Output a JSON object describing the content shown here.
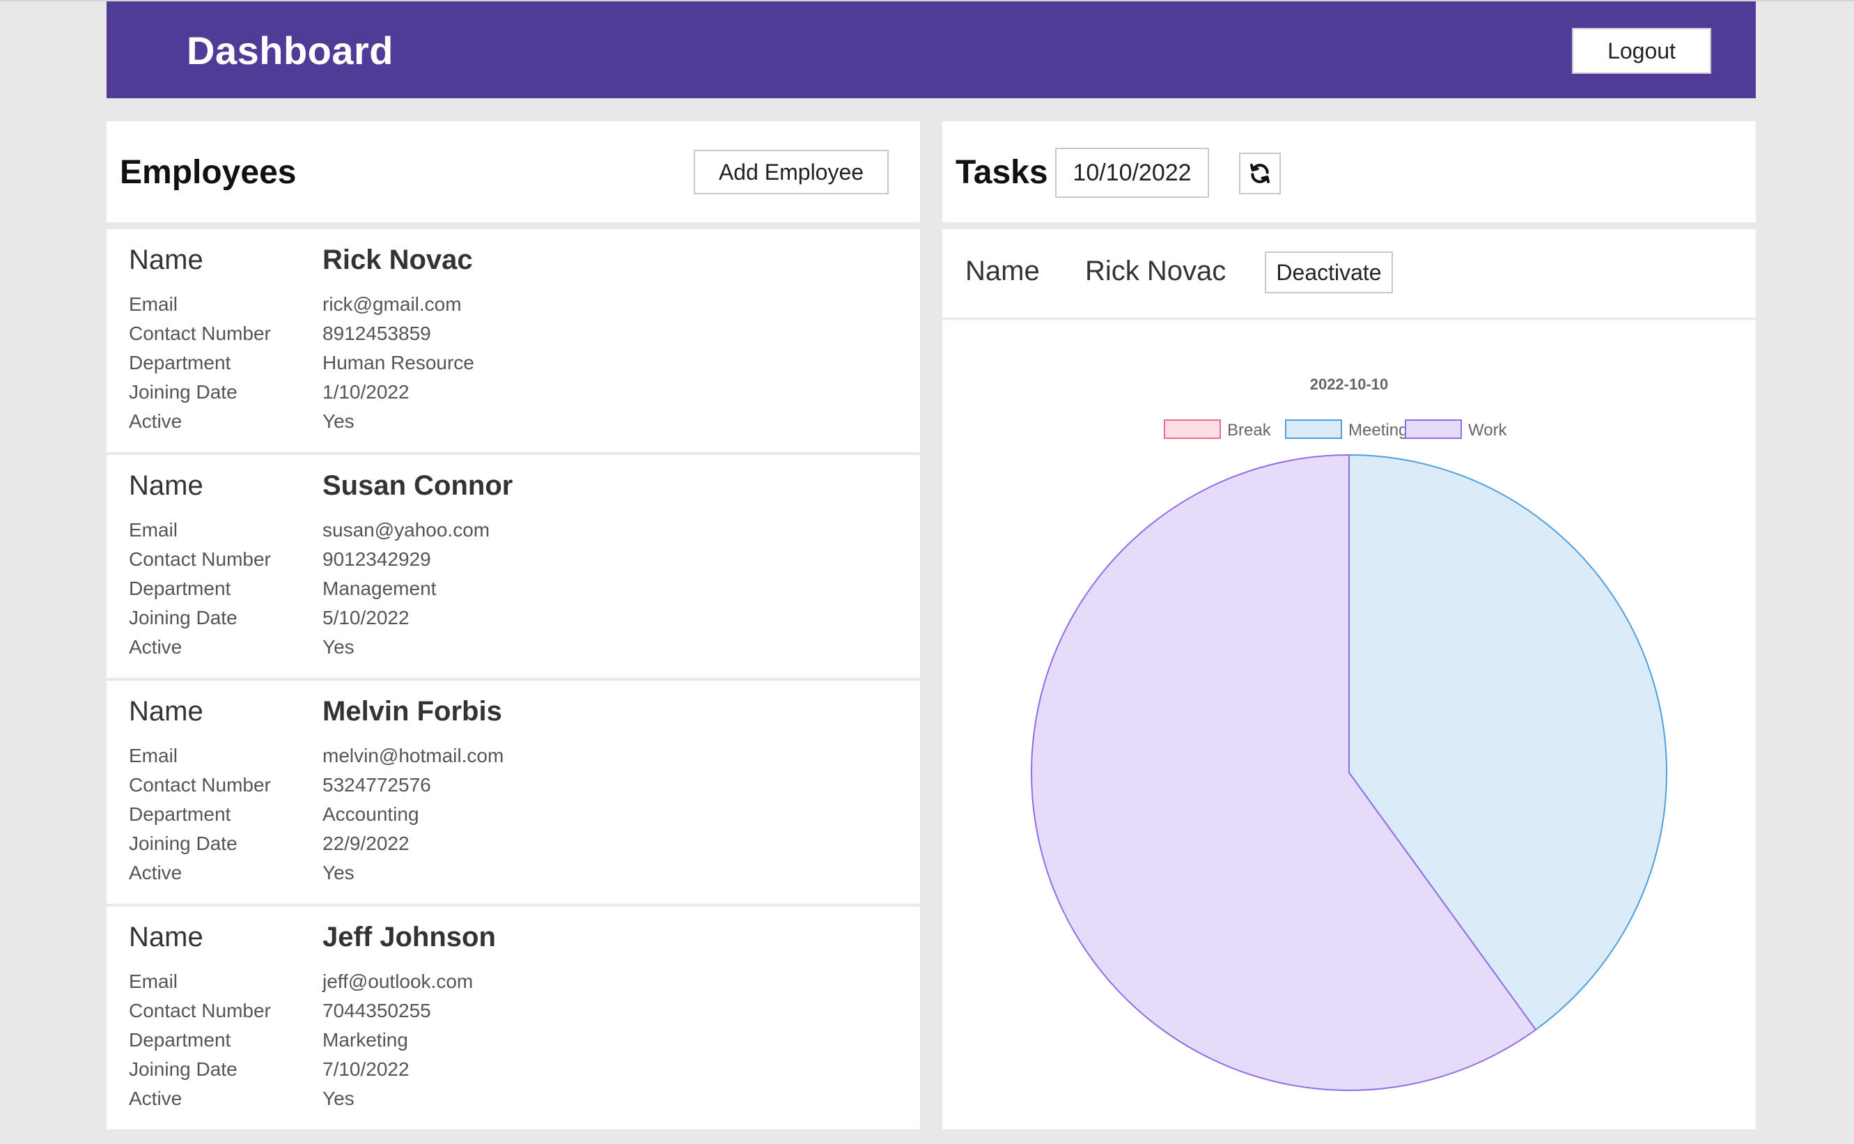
{
  "header": {
    "title": "Dashboard",
    "logout_label": "Logout"
  },
  "employees": {
    "heading": "Employees",
    "add_label": "Add Employee",
    "field_labels": {
      "name": "Name",
      "email": "Email",
      "contact": "Contact Number",
      "department": "Department",
      "joining": "Joining Date",
      "active": "Active"
    },
    "list": [
      {
        "name": "Rick Novac",
        "email": "rick@gmail.com",
        "contact": "8912453859",
        "department": "Human Resource",
        "joining": "1/10/2022",
        "active": "Yes"
      },
      {
        "name": "Susan Connor",
        "email": "susan@yahoo.com",
        "contact": "9012342929",
        "department": "Management",
        "joining": "5/10/2022",
        "active": "Yes"
      },
      {
        "name": "Melvin Forbis",
        "email": "melvin@hotmail.com",
        "contact": "5324772576",
        "department": "Accounting",
        "joining": "22/9/2022",
        "active": "Yes"
      },
      {
        "name": "Jeff Johnson",
        "email": "jeff@outlook.com",
        "contact": "7044350255",
        "department": "Marketing",
        "joining": "7/10/2022",
        "active": "Yes"
      }
    ]
  },
  "tasks": {
    "heading": "Tasks",
    "date_value": "10/10/2022",
    "refresh_icon": "refresh-icon",
    "selected": {
      "label": "Name",
      "name": "Rick Novac",
      "deactivate_label": "Deactivate"
    }
  },
  "chart_data": {
    "type": "pie",
    "title": "2022-10-10",
    "legend_position": "top",
    "categories": [
      "Break",
      "Meeting",
      "Work"
    ],
    "values": [
      0,
      40,
      60
    ],
    "colors": {
      "Break": {
        "fill": "#fde0e6",
        "stroke": "#f06a87"
      },
      "Meeting": {
        "fill": "#dcebf8",
        "stroke": "#4f9fdf"
      },
      "Work": {
        "fill": "#e6dcfa",
        "stroke": "#8e6ee6"
      }
    }
  }
}
